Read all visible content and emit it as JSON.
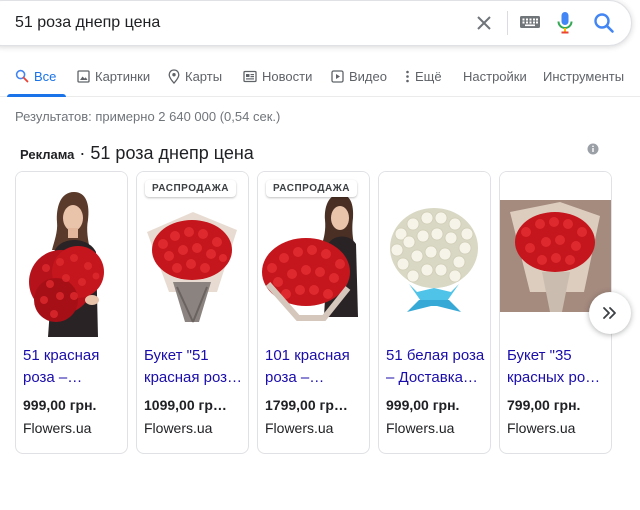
{
  "search": {
    "query": "51 роза днепр цена"
  },
  "tabs": [
    {
      "label": "Все",
      "active": true
    },
    {
      "label": "Картинки"
    },
    {
      "label": "Карты"
    },
    {
      "label": "Новости"
    },
    {
      "label": "Видео"
    },
    {
      "label": "Ещё"
    },
    {
      "label": "Настройки"
    },
    {
      "label": "Инструменты"
    }
  ],
  "stats": "Результатов: примерно 2 640 000 (0,54 сек.)",
  "ads": {
    "label": "Реклама",
    "separator": " · ",
    "title": "51 роза днепр цена"
  },
  "products": [
    {
      "badge": "",
      "title_line1": "51 красная",
      "title_line2": "роза –…",
      "price": "999,00 грн.",
      "store": "Flowers.ua"
    },
    {
      "badge": "РАСПРОДАЖА",
      "title_line1": "Букет \"51",
      "title_line2": "красная роз…",
      "price": "1099,00 гр…",
      "store": "Flowers.ua"
    },
    {
      "badge": "РАСПРОДАЖА",
      "title_line1": "101 красная",
      "title_line2": "роза –…",
      "price": "1799,00 гр…",
      "store": "Flowers.ua"
    },
    {
      "badge": "",
      "title_line1": "51 белая роза",
      "title_line2": "– Доставка…",
      "price": "999,00 грн.",
      "store": "Flowers.ua"
    },
    {
      "badge": "",
      "title_line1": "Букет \"35",
      "title_line2": "красных ро…",
      "price": "799,00 грн.",
      "store": "Flowers.ua"
    }
  ],
  "colors": {
    "accent": "#1a73e8",
    "link": "#1a0dab",
    "rose_red": "#c4161c",
    "rose_white": "#f6f3e8",
    "wrap_blue": "#4fc3e8"
  }
}
